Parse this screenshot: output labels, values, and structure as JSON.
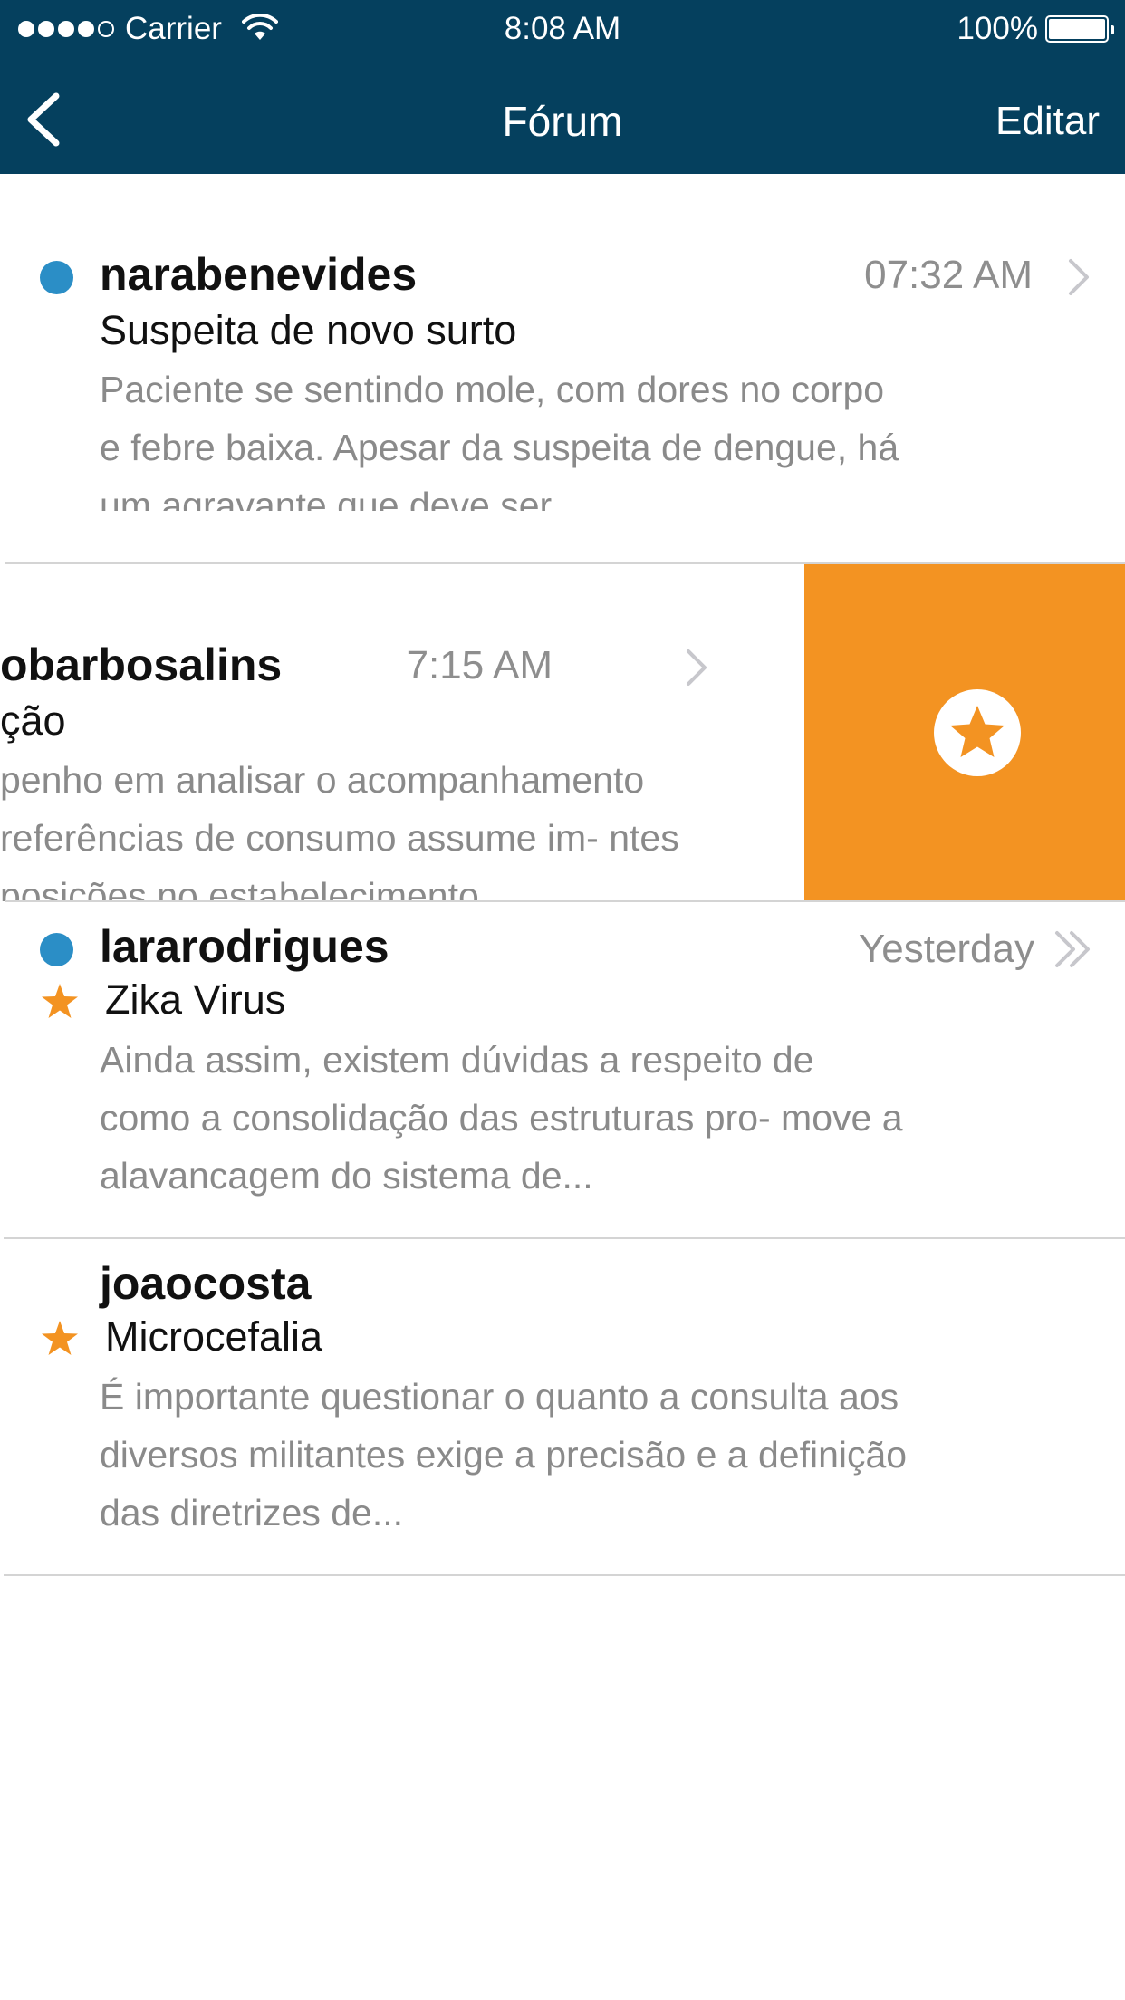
{
  "status_bar": {
    "carrier": "Carrier",
    "time": "8:08 AM",
    "battery": "100%",
    "signal_bars": 4
  },
  "nav": {
    "title": "Fórum",
    "edit_label": "Editar"
  },
  "colors": {
    "nav_bg": "#05405e",
    "unread": "#2b8ec6",
    "star": "#f39322",
    "action_bg": "#f39322"
  },
  "threads": [
    {
      "username": "narabenevides",
      "time": "07:32 AM",
      "subject": "Suspeita de novo surto",
      "preview": "Paciente se sentindo mole, com dores no corpo e febre baixa. Apesar da suspeita de dengue, há um agravante que deve ser...",
      "unread": true,
      "starred": false,
      "chevron": "chevron-right-icon"
    },
    {
      "username": "obarbosalins",
      "time": "7:15 AM",
      "subject": "ção",
      "preview": "penho em analisar o acompanhamento referências de consumo assume im- ntes posições no estabelecimento...",
      "unread": false,
      "starred": false,
      "chevron": "chevron-right-icon",
      "swiped": true,
      "swipe_action": "star-icon"
    },
    {
      "username": "lararodrigues",
      "time": "Yesterday",
      "subject": "Zika Virus",
      "preview": "Ainda assim, existem dúvidas a respeito de como a consolidação das estruturas pro- move a alavancagem do sistema de...",
      "unread": true,
      "starred": true,
      "chevron": "double-chevron-right-icon"
    },
    {
      "username": "joaocosta",
      "time": "",
      "subject": "Microcefalia",
      "preview": "É importante questionar o quanto a consulta aos diversos militantes exige a precisão e a definição das diretrizes de...",
      "unread": false,
      "starred": true,
      "chevron": ""
    }
  ]
}
